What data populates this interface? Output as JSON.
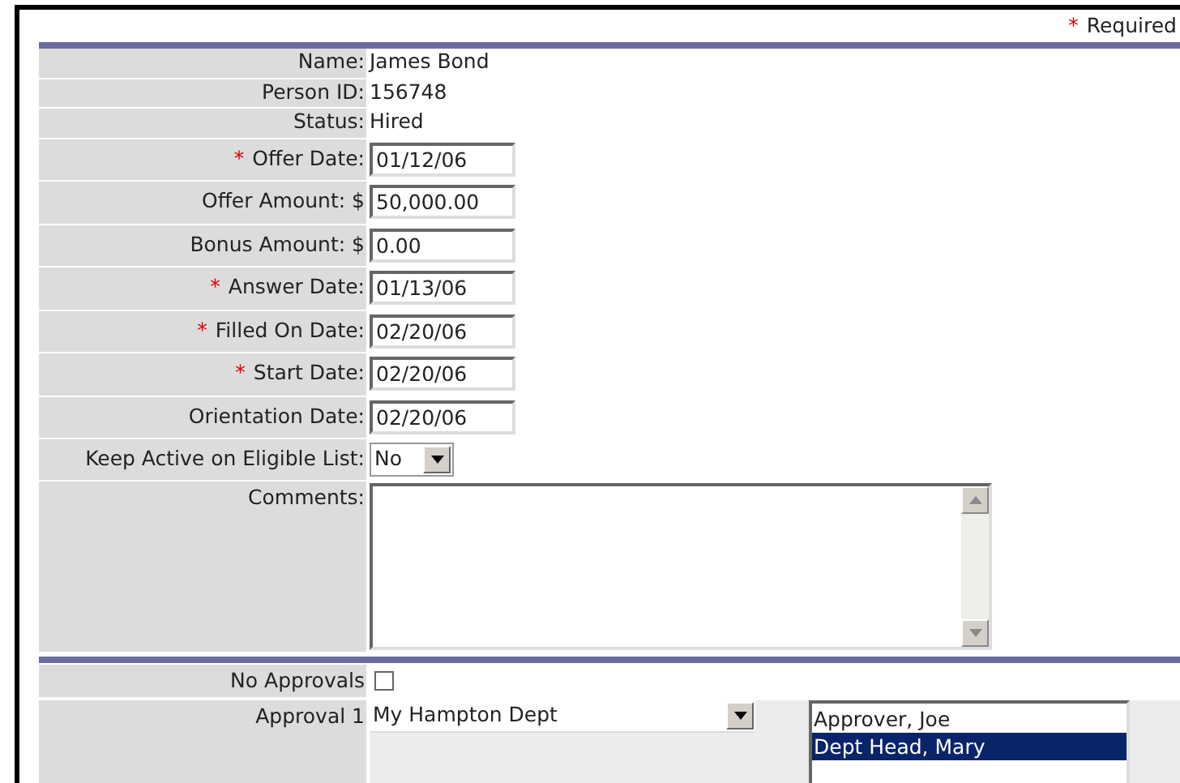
{
  "legend": {
    "mark": "*",
    "text": "Required"
  },
  "fields": [
    {
      "kind": "text",
      "label": "Name:",
      "value": "James Bond"
    },
    {
      "kind": "text",
      "label": "Person ID:",
      "value": "156748"
    },
    {
      "kind": "text",
      "label": "Status:",
      "value": "Hired"
    },
    {
      "kind": "input",
      "required_mark": "*",
      "label": "Offer Date:",
      "value": "01/12/06"
    },
    {
      "kind": "input",
      "label": "Offer Amount: $",
      "value": "50,000.00"
    },
    {
      "kind": "input",
      "label": "Bonus Amount: $",
      "value": "0.00"
    },
    {
      "kind": "input",
      "required_mark": "*",
      "label": "Answer Date:",
      "value": "01/13/06"
    },
    {
      "kind": "input",
      "required_mark": "*",
      "label": "Filled On Date:",
      "value": "02/20/06"
    },
    {
      "kind": "input",
      "required_mark": "*",
      "label": "Start Date:",
      "value": "02/20/06"
    },
    {
      "kind": "input",
      "label": "Orientation Date:",
      "value": "02/20/06"
    },
    {
      "kind": "select",
      "label": "Keep Active on Eligible List:",
      "value": "No"
    },
    {
      "kind": "textarea",
      "label": "Comments:"
    }
  ],
  "approvals": {
    "no_approvals": {
      "label": "No Approvals",
      "checked": false
    },
    "approval_1": {
      "label": "Approval 1",
      "department": "My Hampton Dept",
      "approvers": [
        {
          "name": "Approver, Joe",
          "selected": false
        },
        {
          "name": "Dept Head, Mary",
          "selected": true
        }
      ]
    }
  }
}
